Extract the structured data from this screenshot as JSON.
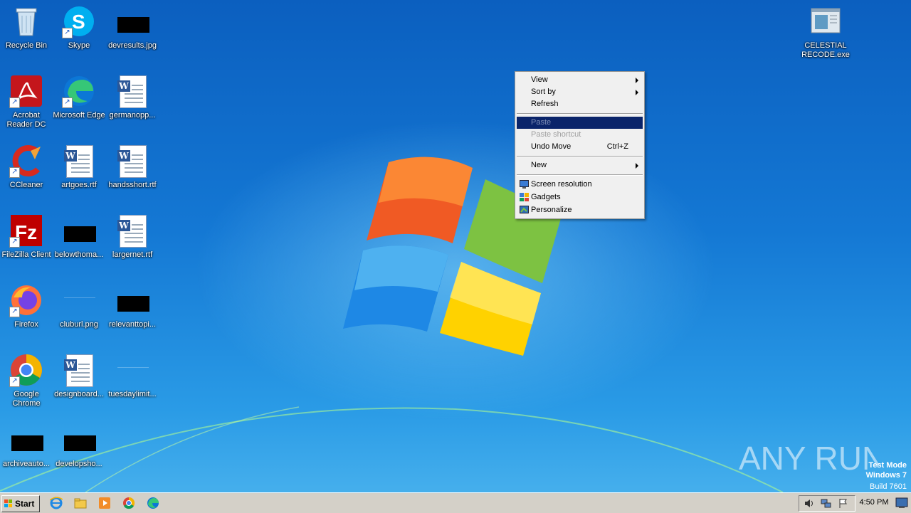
{
  "desktop_icons": [
    {
      "label": "Recycle Bin",
      "icon": "recycle-bin-icon"
    },
    {
      "label": "Skype",
      "icon": "skype-icon"
    },
    {
      "label": "devresults.jpg",
      "icon": "image-file-icon"
    },
    {
      "label": "Acrobat Reader DC",
      "icon": "acrobat-icon"
    },
    {
      "label": "Microsoft Edge",
      "icon": "edge-icon"
    },
    {
      "label": "germanopp...",
      "icon": "word-doc-icon"
    },
    {
      "label": "CCleaner",
      "icon": "ccleaner-icon"
    },
    {
      "label": "artgoes.rtf",
      "icon": "word-doc-icon"
    },
    {
      "label": "handsshort.rtf",
      "icon": "word-doc-icon"
    },
    {
      "label": "FileZilla Client",
      "icon": "filezilla-icon"
    },
    {
      "label": "belowthoma...",
      "icon": "image-file-icon"
    },
    {
      "label": "largernet.rtf",
      "icon": "word-doc-icon"
    },
    {
      "label": "Firefox",
      "icon": "firefox-icon"
    },
    {
      "label": "cluburl.png",
      "icon": "image-file-icon"
    },
    {
      "label": "relevanttopi...",
      "icon": "image-file-icon"
    },
    {
      "label": "Google Chrome",
      "icon": "chrome-icon"
    },
    {
      "label": "designboard...",
      "icon": "word-doc-icon"
    },
    {
      "label": "tuesdaylimit...",
      "icon": "image-file-icon"
    },
    {
      "label": "archiveauto...",
      "icon": "image-file-icon"
    },
    {
      "label": "developsho...",
      "icon": "image-file-icon"
    },
    {
      "label": "CELESTIAL RECODE.exe",
      "icon": "exe-icon"
    }
  ],
  "context_menu": {
    "view": "View",
    "sort_by": "Sort by",
    "refresh": "Refresh",
    "paste": "Paste",
    "paste_shortcut": "Paste shortcut",
    "undo_move": "Undo Move",
    "undo_shortcut": "Ctrl+Z",
    "new": "New",
    "screen_resolution": "Screen resolution",
    "gadgets": "Gadgets",
    "personalize": "Personalize"
  },
  "watermark": {
    "brand": "ANY RUN",
    "line1": "Test Mode",
    "line2": "Windows 7",
    "line3": "Build 7601"
  },
  "taskbar": {
    "start_label": "Start",
    "pinned": [
      "internet-explorer-icon",
      "explorer-folder-icon",
      "media-player-icon",
      "chrome-icon",
      "edge-icon"
    ],
    "clock": "4:50 PM"
  },
  "colors": {
    "menu_highlight": "#0a246a",
    "taskbar": "#d4d0c8"
  }
}
